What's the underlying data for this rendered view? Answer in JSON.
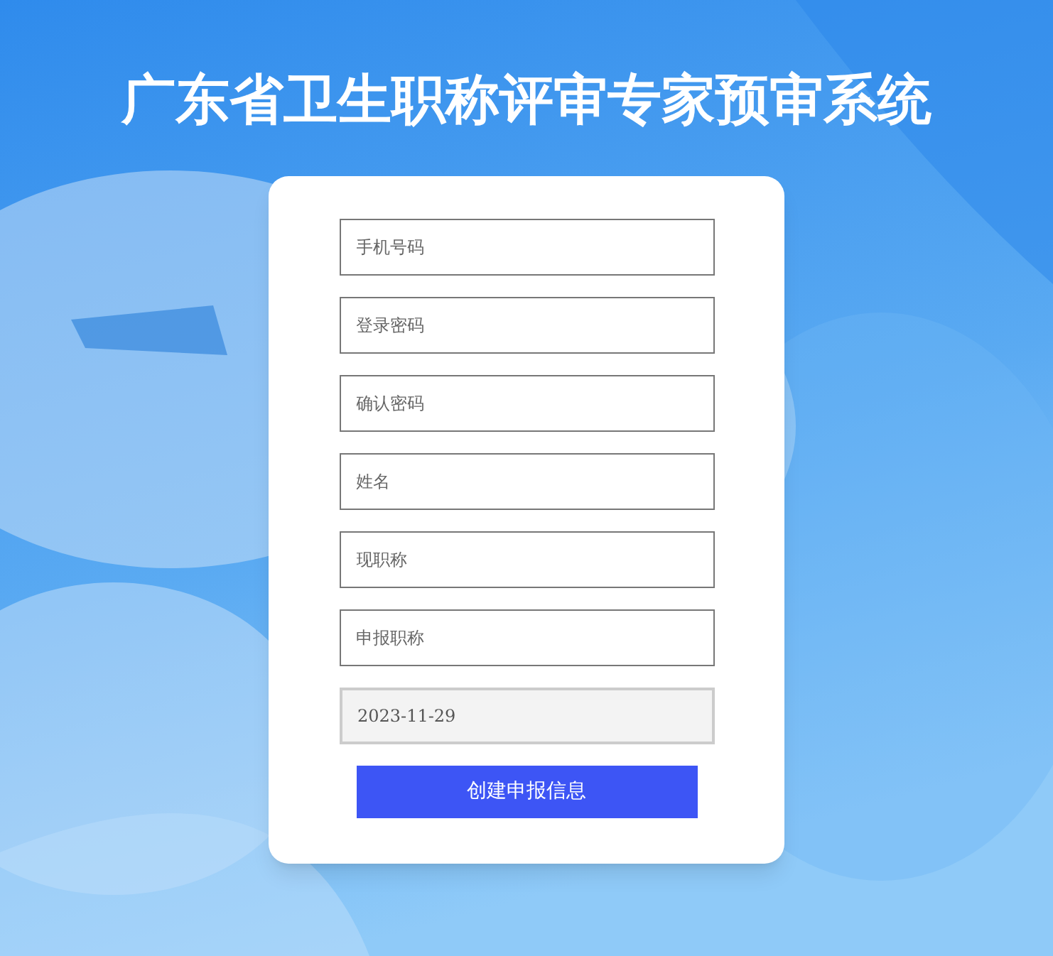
{
  "title": "广东省卫生职称评审专家预审系统",
  "fields": [
    {
      "placeholder": "手机号码",
      "disabled": false
    },
    {
      "placeholder": "登录密码",
      "disabled": false
    },
    {
      "placeholder": "确认密码",
      "disabled": false
    },
    {
      "placeholder": "姓名",
      "disabled": false
    },
    {
      "placeholder": "现职称",
      "disabled": false
    },
    {
      "placeholder": "申报职称",
      "disabled": false
    },
    {
      "value": "2023-11-29",
      "disabled": true
    }
  ],
  "button": "创建申报信息"
}
